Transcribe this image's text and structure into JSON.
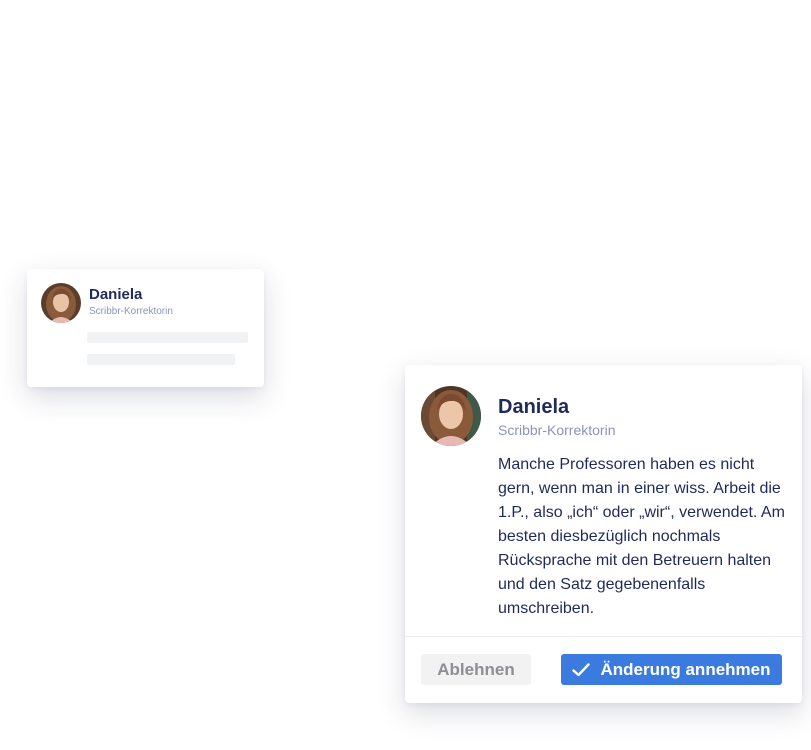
{
  "preview_card": {
    "reviewer_name": "Daniela",
    "reviewer_role": "Scribbr-Korrektorin"
  },
  "comment_card": {
    "reviewer_name": "Daniela",
    "reviewer_role": "Scribbr-Korrektorin",
    "message": "Manche Professoren haben es nicht gern, wenn man in einer wiss. Arbeit die 1.P., also „ich“ oder „wir“, verwendet. Am besten diesbezüglich nochmals Rücksprache mit den Betreuern halten und den Satz gegebenenfalls umschreiben.",
    "reject_label": "Ablehnen",
    "accept_label": "Änderung annehmen",
    "accept_icon": "check-icon"
  },
  "colors": {
    "accent": "#3b7be0",
    "name_text": "#1f2a5a",
    "role_text": "#8a95b8",
    "reject_bg": "#f2f2f3",
    "reject_text": "#8e8e93"
  }
}
